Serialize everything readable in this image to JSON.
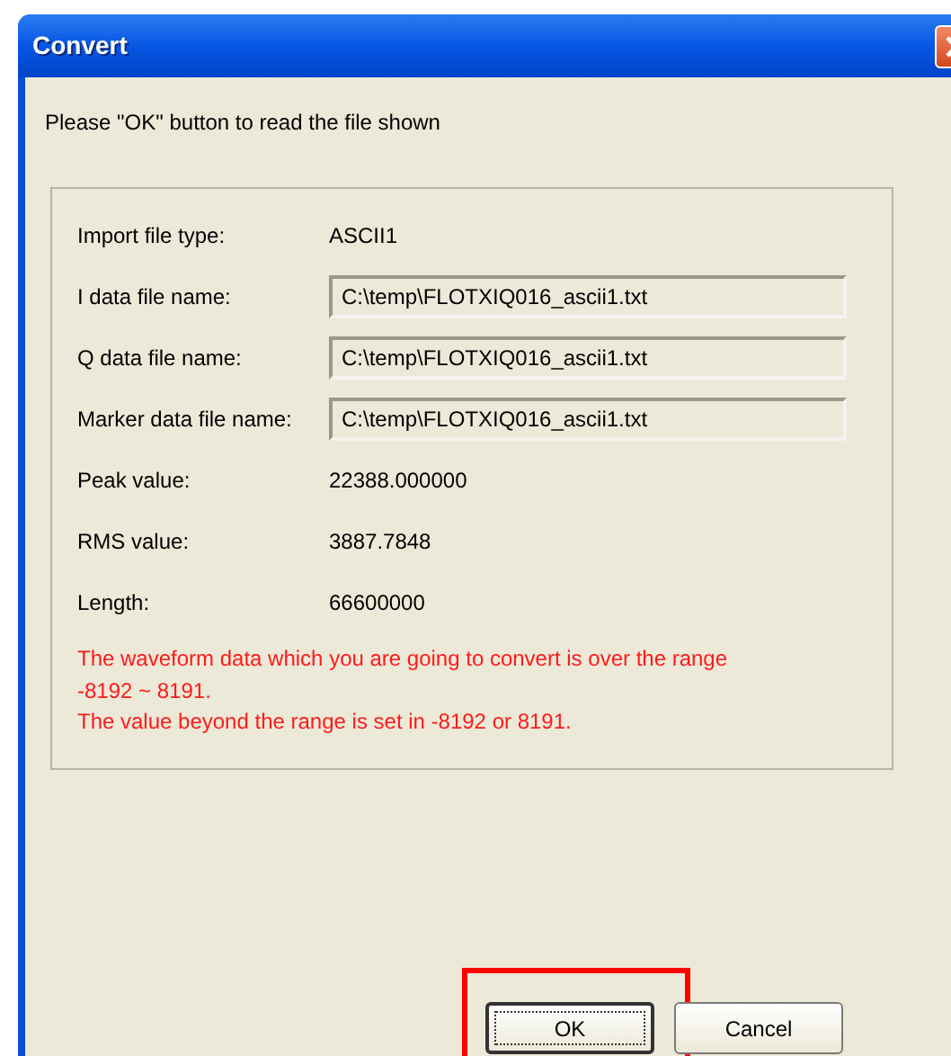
{
  "window": {
    "title": "Convert"
  },
  "instruction": "Please \"OK\" button to read the file shown",
  "rows": [
    {
      "kind": "text",
      "label": "Import file type:",
      "value": "ASCII1"
    },
    {
      "kind": "field",
      "label": "I data file name:",
      "value": "C:\\temp\\FLOTXIQ016_ascii1.txt"
    },
    {
      "kind": "field",
      "label": "Q data file name:",
      "value": "C:\\temp\\FLOTXIQ016_ascii1.txt"
    },
    {
      "kind": "field",
      "label": "Marker data file name:",
      "value": "C:\\temp\\FLOTXIQ016_ascii1.txt"
    },
    {
      "kind": "text",
      "label": "Peak value:",
      "value": "22388.000000"
    },
    {
      "kind": "text",
      "label": "RMS value:",
      "value": "3887.7848"
    },
    {
      "kind": "text",
      "label": "Length:",
      "value": "66600000"
    }
  ],
  "warning": [
    "The waveform data which you are going to convert is over the range",
    "-8192 ~ 8191.",
    "The value beyond the range is set in -8192 or 8191."
  ],
  "buttons": [
    {
      "label": "OK",
      "focused": true,
      "highlighted": true
    },
    {
      "label": "Cancel",
      "focused": false,
      "highlighted": false
    }
  ]
}
